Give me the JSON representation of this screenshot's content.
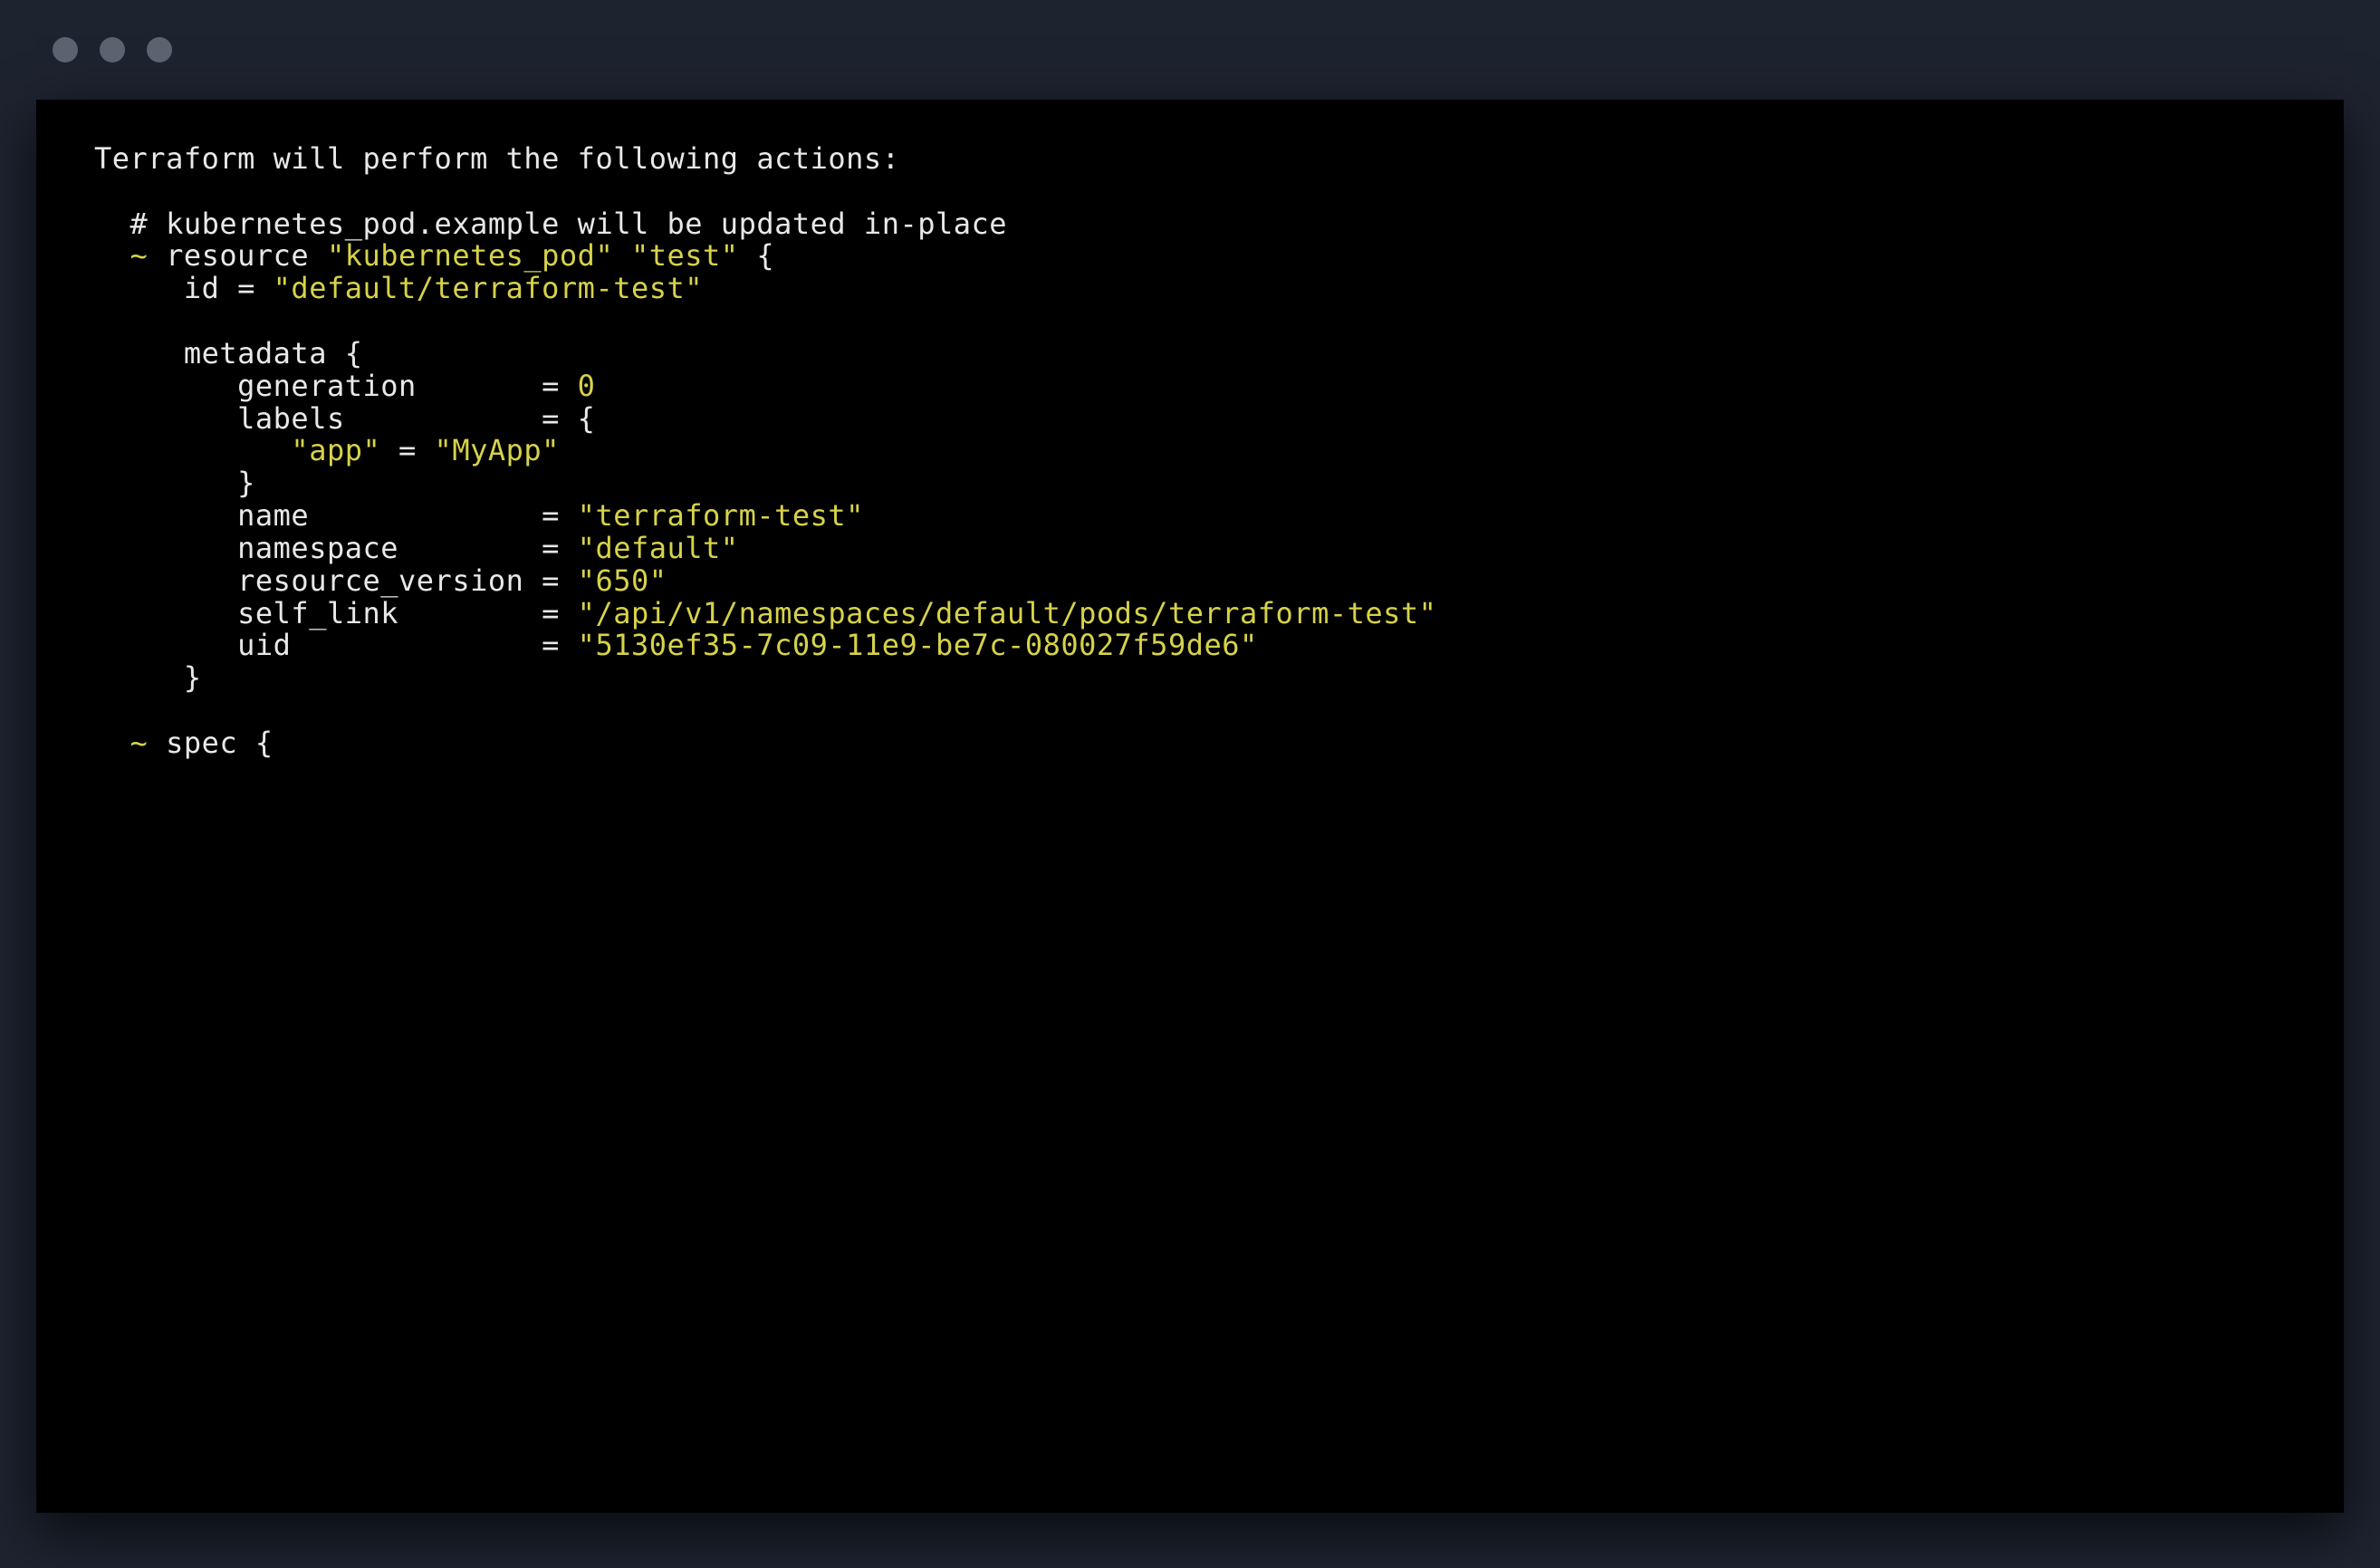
{
  "plan": {
    "header": "Terraform will perform the following actions:",
    "resource_comment": "# kubernetes_pod.example will be updated in-place",
    "tilde1": "~",
    "resource_decl_pre": " resource ",
    "resource_type": "\"kubernetes_pod\"",
    "resource_mid": " ",
    "resource_name": "\"test\"",
    "resource_open": " {",
    "id_key": "id",
    "eq": "=",
    "id_val": "\"default/terraform-test\"",
    "metadata_open": "metadata {",
    "generation_key": "generation",
    "generation_val": "0",
    "labels_key": "labels",
    "labels_open": "{",
    "label_app_key": "\"app\"",
    "label_app_val": "\"MyApp\"",
    "labels_close": "}",
    "name_key": "name",
    "name_val": "\"terraform-test\"",
    "namespace_key": "namespace",
    "namespace_val": "\"default\"",
    "resver_key": "resource_version",
    "resver_val": "\"650\"",
    "selflink_key": "self_link",
    "selflink_val": "\"/api/v1/namespaces/default/pods/terraform-test\"",
    "uid_key": "uid",
    "uid_val": "\"5130ef35-7c09-11e9-be7c-080027f59de6\"",
    "metadata_close": "}",
    "tilde2": "~",
    "spec_open": " spec {"
  }
}
